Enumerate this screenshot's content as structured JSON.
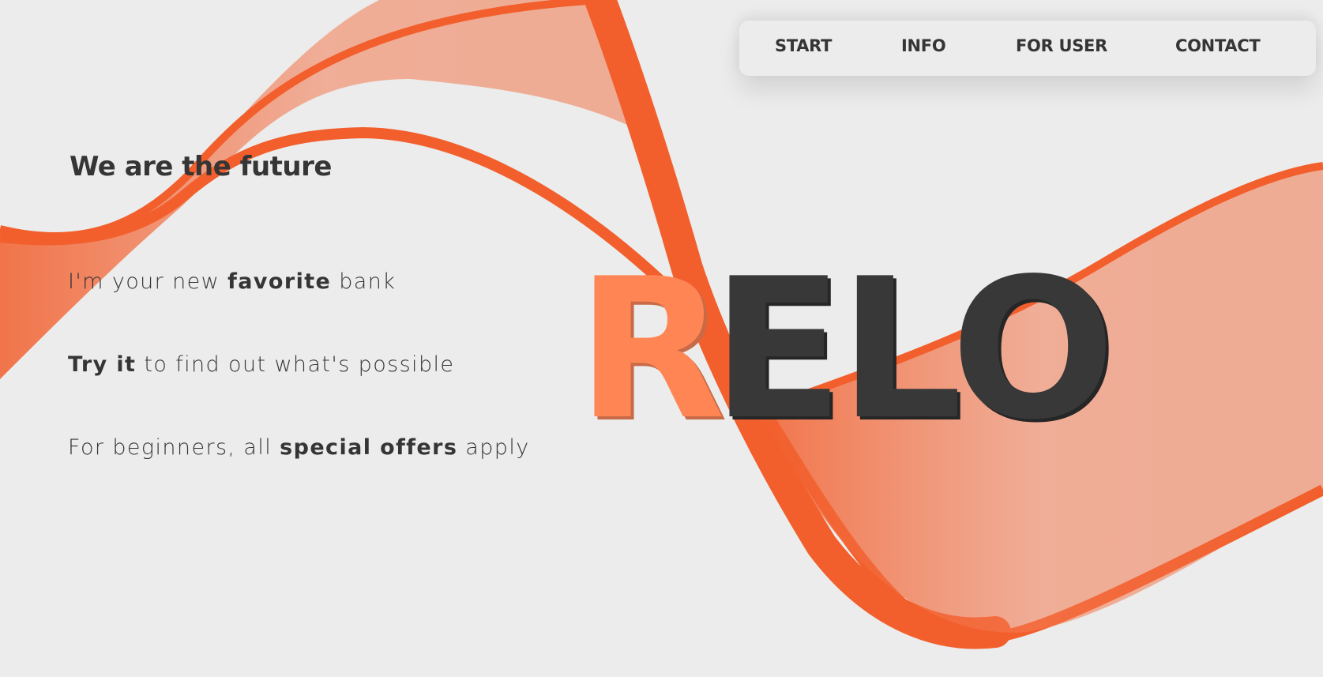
{
  "nav": {
    "items": [
      {
        "label": "START"
      },
      {
        "label": "INFO"
      },
      {
        "label": "FOR USER"
      },
      {
        "label": "CONTACT"
      }
    ]
  },
  "hero": {
    "tagline": "We are the future",
    "line1": {
      "pre": "I'm your new ",
      "bold": "favorite",
      "post": " bank"
    },
    "line2": {
      "bold": "Try it",
      "post": " to find out what's possible"
    },
    "line3": {
      "pre": "For beginners, all ",
      "bold": "special offers",
      "post": " apply"
    }
  },
  "logo": {
    "first_letter": "R",
    "rest": "ELO"
  },
  "colors": {
    "background": "#ebeceb",
    "accent": "#f25f2d",
    "accent_light": "#ff8654",
    "text_dark": "#353535"
  }
}
